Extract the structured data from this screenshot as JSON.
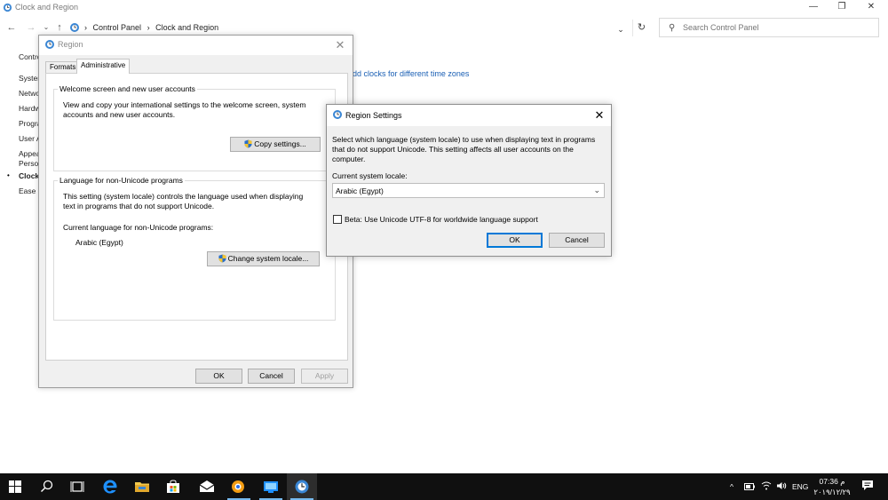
{
  "main_window": {
    "title": "Clock and Region",
    "controls": {
      "minimize": "—",
      "restore": "❐",
      "close": "✕"
    }
  },
  "address_bar": {
    "crumbs": [
      "›",
      "Control Panel",
      "›",
      "Clock and Region"
    ],
    "dropdown": "⌄",
    "refresh": "↻"
  },
  "search": {
    "placeholder": "Search Control Panel"
  },
  "cp_sidebar": {
    "items": [
      {
        "label": "Control Panel Home",
        "active": false
      },
      {
        "label": "System and Security",
        "active": false
      },
      {
        "label": "Network and Internet",
        "active": false
      },
      {
        "label": "Hardware and Sound",
        "active": false
      },
      {
        "label": "Programs",
        "active": false
      },
      {
        "label": "User Accounts",
        "active": false
      },
      {
        "label": "Appearance and",
        "active": false
      },
      {
        "label": "Personalization",
        "active": false
      },
      {
        "label": "Clock and Region",
        "active": true
      },
      {
        "label": "Ease of Access",
        "active": false
      }
    ],
    "bullet": "•"
  },
  "cp_link": "dd clocks for different time zones",
  "region_dialog": {
    "title": "Region",
    "close": "✕",
    "tabs": [
      {
        "label": "Formats",
        "selected": false
      },
      {
        "label": "Administrative",
        "selected": true
      }
    ],
    "welcome_group": {
      "legend": "Welcome screen and new user accounts",
      "description_line1": "View and copy your international settings to the welcome screen, system",
      "description_line2": "accounts and new user accounts.",
      "copy_button": "Copy settings..."
    },
    "nonunicode_group": {
      "legend": "Language for non-Unicode programs",
      "description_line1": "This setting (system locale) controls the language used when displaying",
      "description_line2": "text in programs that do not support Unicode.",
      "current_label": "Current language for non-Unicode programs:",
      "current_value": "Arabic (Egypt)",
      "change_button": "Change system locale..."
    },
    "ok": "OK",
    "cancel": "Cancel",
    "apply": "Apply"
  },
  "region_settings_dialog": {
    "title": "Region Settings",
    "close": "✕",
    "description_line1": "Select which language (system locale) to use when displaying text in programs",
    "description_line2": "that do not support Unicode. This setting affects all user accounts on the",
    "description_line3": "computer.",
    "locale_label": "Current system locale:",
    "locale_value": "Arabic (Egypt)",
    "chevron": "⌄",
    "beta_label": "Beta: Use Unicode UTF-8 for worldwide language support",
    "beta_checked": false,
    "ok": "OK",
    "cancel": "Cancel"
  },
  "taskbar": {
    "tray_chevron": "^",
    "language": "ENG",
    "time": "07:36 م",
    "date": "٢٠١٩/١٢/٢٩"
  },
  "colors": {
    "accent": "#0078d7",
    "taskbar": "#101010",
    "link": "#1a5fb4"
  }
}
